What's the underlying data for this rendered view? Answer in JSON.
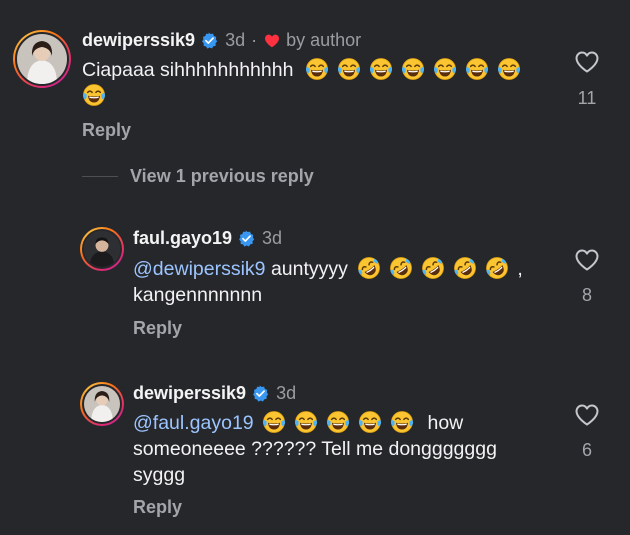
{
  "comments": [
    {
      "username": "dewiperssik9",
      "time": "3d",
      "separator": "·",
      "by_author": "by author",
      "text": "Ciapaaa sihhhhhhhhhhh",
      "emoji": "face-with-tears-of-joy",
      "reply_label": "Reply",
      "likes": "11"
    },
    {
      "username": "faul.gayo19",
      "time": "3d",
      "mention": "@dewiperssik9",
      "text_a": "auntyyyy",
      "text_b": ", kangennnnnnn",
      "emoji": "rolling-on-the-floor-laughing",
      "reply_label": "Reply",
      "likes": "8"
    },
    {
      "username": "dewiperssik9",
      "time": "3d",
      "mention": "@faul.gayo19",
      "text_a": "how",
      "text_b": "someoneeee ?????? Tell me donggggggg",
      "text_c": "syggg",
      "emoji": "face-with-tears-of-joy",
      "reply_label": "Reply",
      "likes": "6"
    }
  ],
  "view_replies_label": "View 1 previous reply",
  "colors": {
    "background": "#25272b",
    "mention": "#9cc4ff",
    "verified": "#3897f0",
    "author_heart": "#ff3040",
    "muted": "#a3a5aa"
  }
}
